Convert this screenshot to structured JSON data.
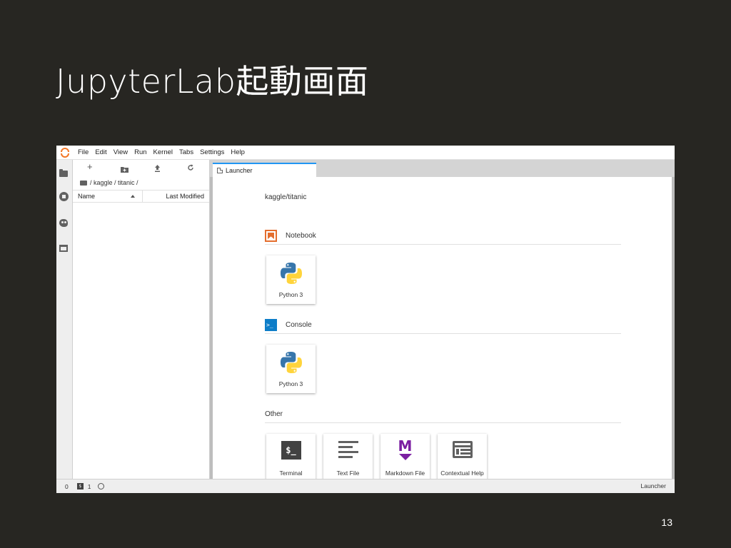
{
  "slide": {
    "title": "JupyterLab起動画面",
    "page_number": "13"
  },
  "menubar": {
    "logo_icon": "jupyter-logo-icon",
    "items": [
      "File",
      "Edit",
      "View",
      "Run",
      "Kernel",
      "Tabs",
      "Settings",
      "Help"
    ]
  },
  "left_sidebar": {
    "icons": [
      "folder-icon",
      "running-icon",
      "palette-icon",
      "tabs-icon"
    ]
  },
  "file_browser": {
    "toolbar": {
      "new_launcher": "+",
      "icons": [
        "plus-icon",
        "new-folder-icon",
        "upload-icon",
        "refresh-icon"
      ]
    },
    "breadcrumb": "/ kaggle / titanic /",
    "columns": {
      "name": "Name",
      "last_modified": "Last Modified"
    }
  },
  "main": {
    "tab_label": "Launcher",
    "launcher": {
      "cwd": "kaggle/titanic",
      "sections": {
        "notebook": {
          "title": "Notebook",
          "cards": [
            {
              "label": "Python 3",
              "icon": "python-icon"
            }
          ]
        },
        "console": {
          "title": "Console",
          "icon_text": ">_",
          "cards": [
            {
              "label": "Python 3",
              "icon": "python-icon"
            }
          ]
        },
        "other": {
          "title": "Other",
          "cards": [
            {
              "label": "Terminal",
              "icon": "terminal-icon",
              "icon_text": "$_"
            },
            {
              "label": "Text File",
              "icon": "text-file-icon"
            },
            {
              "label": "Markdown File",
              "icon": "markdown-icon",
              "icon_text": "M"
            },
            {
              "label": "Contextual Help",
              "icon": "contextual-help-icon"
            }
          ]
        }
      }
    }
  },
  "statusbar": {
    "kernels": "0",
    "terminals": "1",
    "right_label": "Launcher",
    "terminal_icon_text": "$"
  },
  "colors": {
    "slide_background": "#272622",
    "accent_blue": "#2196f3",
    "notebook_orange": "#e46e2e",
    "console_blue": "#0d7dc8",
    "markdown_purple": "#7b1fa2",
    "jupyter_orange": "#f37726"
  }
}
